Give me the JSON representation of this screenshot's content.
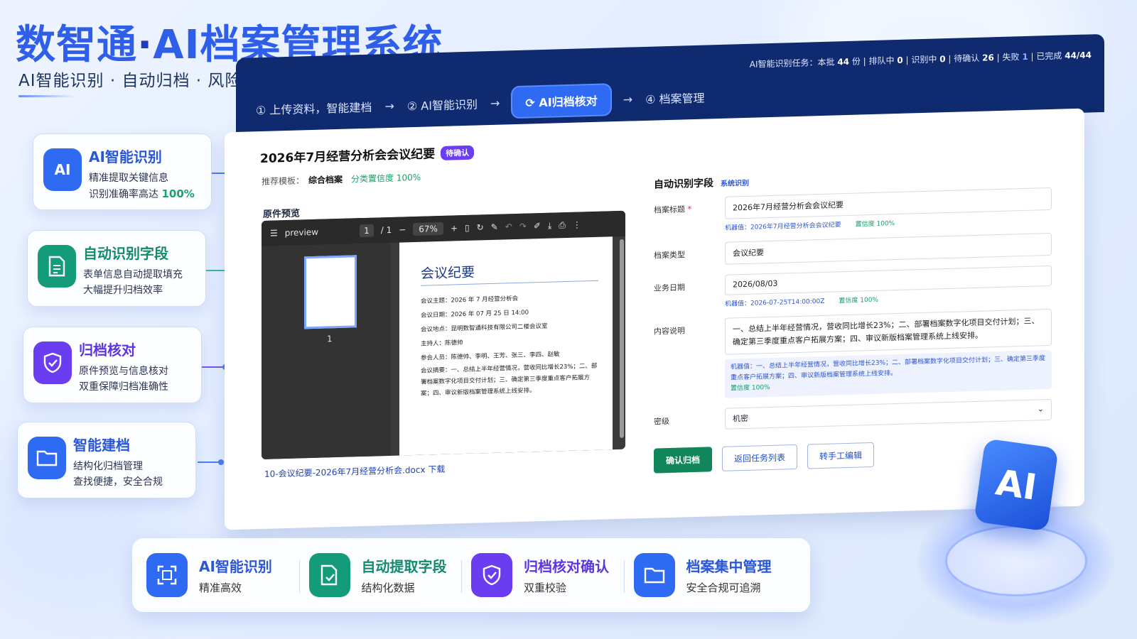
{
  "hero": {
    "brand": "数智通",
    "dot": "·",
    "title": "AI档案管理系统",
    "subtitle": "AI智能识别 · 自动归档 · 风险管控"
  },
  "features": [
    {
      "title": "AI智能识别",
      "line1": "精准提取关键信息",
      "line2": "识别准确率高达",
      "highlight": "100%",
      "icon": "ai-chip-icon",
      "color": "#2f6bf2"
    },
    {
      "title": "自动识别字段",
      "line1": "表单信息自动提取填充",
      "line2": "大幅提升归档效率",
      "icon": "document-icon",
      "color": "#139b7a"
    },
    {
      "title": "归档核对",
      "line1": "原件预览与信息核对",
      "line2": "双重保障归档准确性",
      "icon": "shield-check-icon",
      "color": "#6a3df0"
    },
    {
      "title": "智能建档",
      "line1": "结构化归档管理",
      "line2": "查找便捷，安全合规",
      "icon": "folder-icon",
      "color": "#2f6bf2"
    }
  ],
  "steps": [
    {
      "label": "① 上传资料，智能建档"
    },
    {
      "label": "② AI智能识别"
    },
    {
      "label": "AI归档核对",
      "active": true
    },
    {
      "label": "④ 档案管理"
    }
  ],
  "task": {
    "prefix": "AI智能识别任务：本批",
    "batch": "44",
    "unit": "份",
    "queued_label": "排队中",
    "queued": "0",
    "recognizing_label": "识别中",
    "recognizing": "0",
    "pending_label": "待确认",
    "pending": "26",
    "failed_label": "失败",
    "failed": "1",
    "done_label": "已完成",
    "done": "44/44"
  },
  "record": {
    "title": "2026年7月经营分析会会议纪要",
    "status": "待确认",
    "template_label": "推荐模板：",
    "template": "综合档案",
    "template_conf": "分类置信度 100%",
    "preview_label": "原件预览",
    "file_link": "10-会议纪要-2026年7月经营分析会.docx 下载"
  },
  "viewer": {
    "name": "preview",
    "page": "1",
    "pages": "/ 1",
    "zoom": "67%",
    "thumb_num": "1",
    "doc_title": "会议纪要",
    "lines": [
      "会议主题：2026 年 7 月经营分析会",
      "会议日期：2026 年 07 月 25 日 14:00",
      "会议地点：昆明数智通科技有限公司二楼会议室",
      "主持人：陈德帅",
      "参会人员：陈德帅、李明、王芳、张三、李四、赵敏"
    ],
    "summary": "会议摘要：一、总结上半年经营情况，营收同比增长23%；二、部署档案数字化项目交付计划；三、确定第三季度重点客户拓展方案；四、审议新版档案管理系统上线安排。"
  },
  "fields": {
    "header": "自动识别字段",
    "header_tag": "系统识别",
    "title_label": "档案标题",
    "title_req": "*",
    "title_value": "2026年7月经营分析会会议纪要",
    "title_machine": "机器值：2026年7月经营分析会会议纪要",
    "title_conf": "置信度 100%",
    "type_label": "档案类型",
    "type_value": "会议纪要",
    "date_label": "业务日期",
    "date_value": "2026/08/03",
    "date_machine": "机器值：2026-07-25T14:00:00Z",
    "date_conf": "置信度 100%",
    "content_label": "内容说明",
    "content_value": "一、总结上半年经营情况，营收同比增长23%；二、部署档案数字化项目交付计划；三、确定第三季度重点客户拓展方案；四、审议新版档案管理系统上线安排。",
    "content_machine": "机器值：一、总结上半年经营情况，营收同比增长23%；二、部署档案数字化项目交付计划；三、确定第三季度重点客户拓展方案；四、审议新版档案管理系统上线安排。",
    "content_conf": "置信度 100%",
    "secret_label": "密级",
    "secret_value": "机密"
  },
  "buttons": {
    "confirm": "确认归档",
    "back": "返回任务列表",
    "manual": "转手工编辑"
  },
  "strip": [
    {
      "title": "AI智能识别",
      "sub": "精准高效",
      "icon": "scan-icon",
      "color": "#2f6bf2"
    },
    {
      "title": "自动提取字段",
      "sub": "结构化数据",
      "icon": "document-check-icon",
      "color": "#139b7a"
    },
    {
      "title": "归档核对确认",
      "sub": "双重校验",
      "icon": "shield-check-icon",
      "color": "#6a3df0"
    },
    {
      "title": "档案集中管理",
      "sub": "安全合规可追溯",
      "icon": "folder-icon",
      "color": "#2f6bf2"
    }
  ],
  "cube": {
    "label": "AI"
  }
}
